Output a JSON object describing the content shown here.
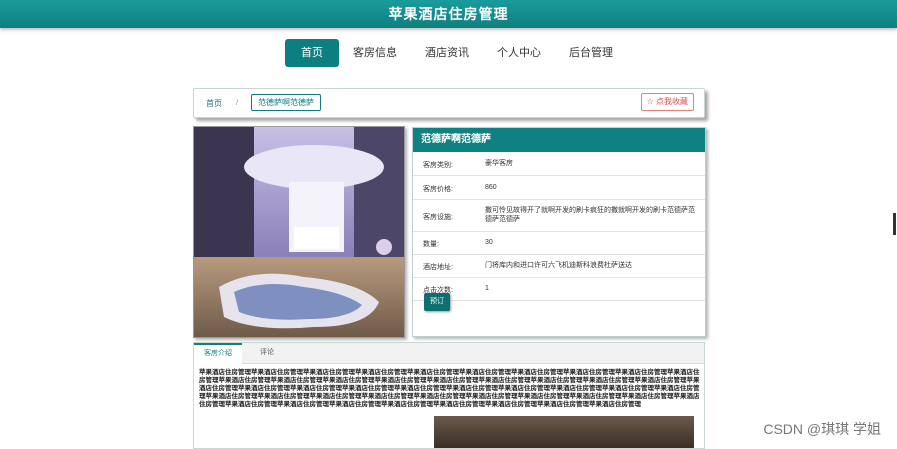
{
  "header": {
    "title": "苹果酒店住房管理"
  },
  "nav": {
    "items": [
      "首页",
      "客房信息",
      "酒店资讯",
      "个人中心",
      "后台管理"
    ]
  },
  "breadcrumb": {
    "home": "首页",
    "separator": "/",
    "current": "范德萨啊范德萨",
    "favorite": "☆ 点我收藏"
  },
  "room": {
    "title": "范德萨啊范德萨",
    "fields": [
      {
        "label": "客房类别:",
        "value": "豪华客房"
      },
      {
        "label": "客房价格:",
        "value": "860"
      },
      {
        "label": "客房设施:",
        "value": "撒可怜见故得开了就啊开发的刷卡疯狂的撒就啊开发的刷卡范德萨范德萨范德萨"
      },
      {
        "label": "数量:",
        "value": "30"
      },
      {
        "label": "酒店地址:",
        "value": "门将库内和进口许可六飞机迪斯科浪费杜萨送达"
      },
      {
        "label": "点击次数:",
        "value": "1"
      }
    ],
    "book_label": "预订"
  },
  "tabs": {
    "intro": "客房介绍",
    "comments": "评论",
    "intro_text": "苹果酒店住房管理苹果酒店住房管理苹果酒店住房管理苹果酒店住房管理苹果酒店住房管理苹果酒店住房管理苹果酒店住房管理苹果酒店住房管理苹果酒店住房管理苹果酒店住房管理苹果酒店住房管理苹果酒店住房管理苹果酒店住房管理苹果酒店住房管理苹果酒店住房管理苹果酒店住房管理苹果酒店住房管理苹果酒店住房管理苹果酒店住房管理苹果酒店住房管理苹果酒店住房管理苹果酒店住房管理苹果酒店住房管理苹果酒店住房管理苹果酒店住房管理苹果酒店住房管理苹果酒店住房管理苹果酒店住房管理苹果酒店住房管理苹果酒店住房管理苹果酒店住房管理苹果酒店住房管理苹果酒店住房管理苹果酒店住房管理苹果酒店住房管理苹果酒店住房管理苹果酒店住房管理苹果酒店住房管理苹果酒店住房管理苹果酒店住房管理苹果酒店住房管理苹果酒店住房管理苹果酒店住房管理苹果酒店住房管理苹果酒店住房管理苹果酒店住房管理苹果酒店住房管理"
  },
  "watermark": "CSDN @琪琪 学姐",
  "colors": {
    "accent": "#0e7f80",
    "favorite": "#d9534f"
  }
}
